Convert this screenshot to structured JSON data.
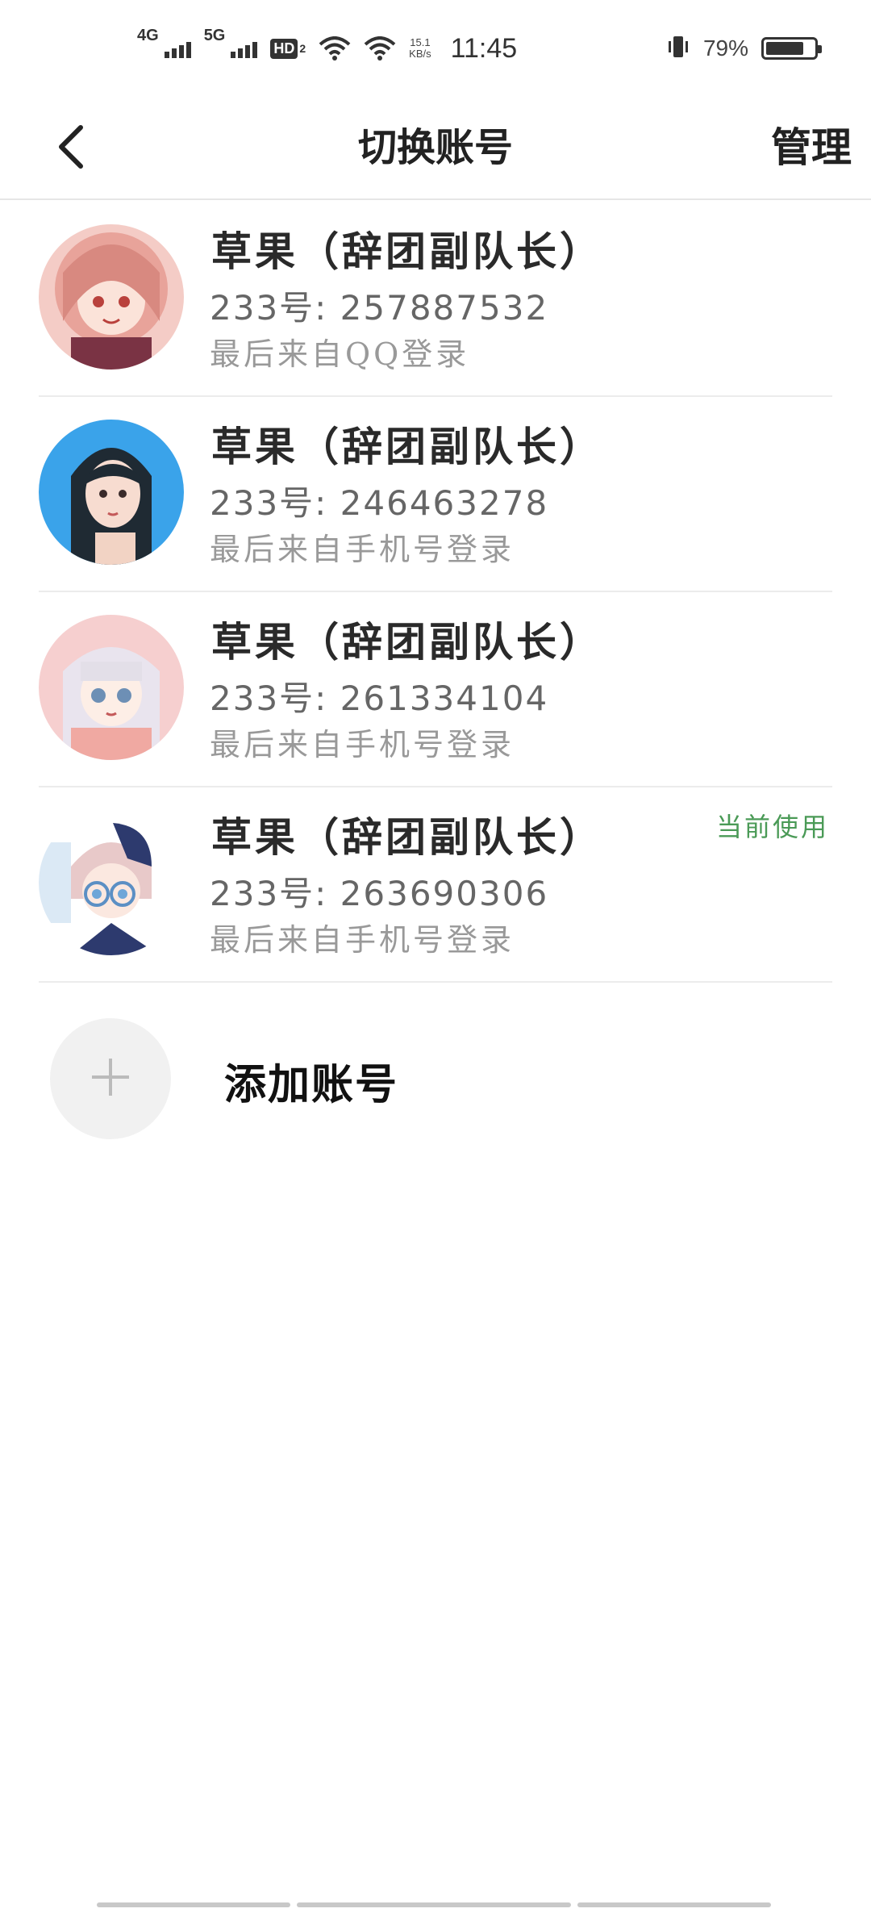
{
  "status_bar": {
    "net1": "4G",
    "net2": "5G",
    "hd": "HD",
    "hd_sub": "2",
    "speed_value": "15.1",
    "speed_unit": "KB/s",
    "time": "11:45",
    "battery_pct": "79%",
    "battery_level": 0.79
  },
  "header": {
    "title": "切换账号",
    "manage": "管理",
    "back_icon": "chevron-left-icon"
  },
  "accounts": [
    {
      "name": "草果（辞团副队长）",
      "id_text": "233号: 257887532",
      "login_text": "最后来自QQ登录",
      "current": "",
      "avatar_colors": [
        "#f2b3ae",
        "#d77f7a"
      ]
    },
    {
      "name": "草果（辞团副队长）",
      "id_text": "233号: 246463278",
      "login_text": "最后来自手机号登录",
      "current": "",
      "avatar_colors": [
        "#3aa3ea",
        "#1f2a33"
      ]
    },
    {
      "name": "草果（辞团副队长）",
      "id_text": "233号: 261334104",
      "login_text": "最后来自手机号登录",
      "current": "",
      "avatar_colors": [
        "#f6cfcf",
        "#e9e4ee"
      ]
    },
    {
      "name": "草果（辞团副队长）",
      "id_text": "233号: 263690306",
      "login_text": "最后来自手机号登录",
      "current": "当前使用",
      "avatar_colors": [
        "#dbe9f5",
        "#2d3a6e"
      ]
    }
  ],
  "add_account": {
    "label": "添加账号",
    "icon": "plus-icon"
  },
  "colors": {
    "accent_green": "#4a9a56",
    "divider": "#ececec"
  }
}
